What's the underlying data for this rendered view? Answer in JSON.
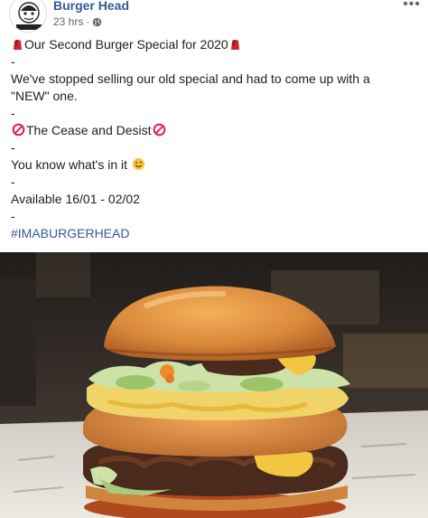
{
  "post": {
    "page_name": "Burger Head",
    "timestamp": "23 hrs",
    "separator": "·",
    "privacy_icon": "globe-icon",
    "more_icon": "more-options-icon",
    "more_label": "•••",
    "lines": [
      {
        "pre": "",
        "text": "Our Second Burger Special for 2020",
        "icon": "fez-icon"
      },
      {
        "text": "-"
      },
      {
        "text": "We've stopped selling our old special and had to come up with a"
      },
      {
        "text": "\"NEW\" one."
      },
      {
        "text": "-"
      },
      {
        "text": "The Cease and Desist",
        "icon": "prohibited-icon"
      },
      {
        "text": "-"
      },
      {
        "text": "You know what's in it",
        "icon": "wink-icon"
      },
      {
        "text": "-"
      },
      {
        "text": "Available 16/01 - 02/02"
      },
      {
        "text": "-"
      }
    ],
    "hashtag": "#IMABURGERHEAD",
    "photo": {
      "subject": "burger-photo",
      "colors": {
        "bun": "#d98a3a",
        "patty": "#4a2a1c",
        "cheese": "#f2c640",
        "lettuce": "#cde2a8",
        "paper": "#e6e3dc"
      }
    }
  }
}
